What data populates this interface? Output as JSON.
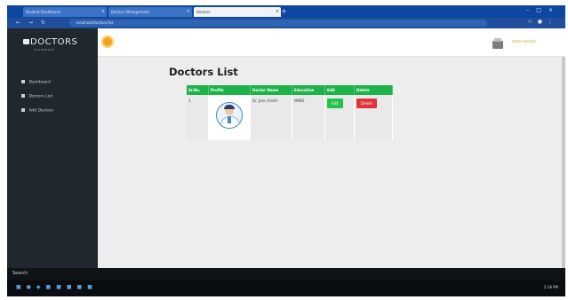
{
  "browser": {
    "tabs": [
      {
        "label": "Student Dashboard",
        "active": false
      },
      {
        "label": "Doctors Management",
        "active": false
      },
      {
        "label": "Doctors",
        "active": true
      }
    ],
    "url": "localhost/doctors/list"
  },
  "sidebar": {
    "brand": "DOCTORS",
    "brand_sub": "DASHBOARD",
    "items": [
      {
        "label": "Dashboard"
      },
      {
        "label": "Doctors List"
      },
      {
        "label": "Add Doctors"
      }
    ]
  },
  "header": {
    "user": "Administrator"
  },
  "page": {
    "title": "Doctors List"
  },
  "table": {
    "headers": [
      "Sr.No.",
      "Profile",
      "Doctor Name",
      "Education",
      "Edit",
      "Delete"
    ],
    "rows": [
      {
        "sr": "1",
        "name": "Dr. John Smith",
        "education": "MBBS",
        "edit": "Edit",
        "delete": "Delete"
      }
    ]
  },
  "taskbar": {
    "search": "Search",
    "time": "2:18 PM"
  },
  "colors": {
    "sidebar": "#20272e",
    "table_header": "#1fb24a",
    "edit": "#27c24c",
    "delete": "#e0323a",
    "accent": "#f2a31b"
  }
}
